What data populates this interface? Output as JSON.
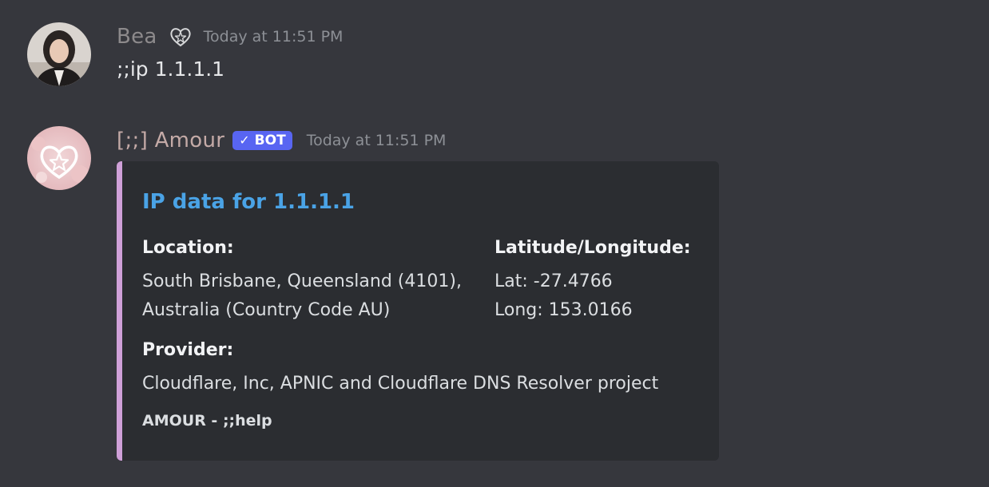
{
  "messages": [
    {
      "author": "Bea",
      "badge_icon": "heart-star-icon",
      "timestamp": "Today at 11:51 PM",
      "content": ";;ip 1.1.1.1"
    },
    {
      "author": "[;;] Amour",
      "bot_tag": "BOT",
      "timestamp": "Today at 11:51 PM",
      "embed": {
        "title": "IP data for 1.1.1.1",
        "accent_color": "#cfa0d8",
        "fields": {
          "location": {
            "name": "Location:",
            "lines": [
              "South Brisbane, Queensland (4101),",
              "Australia (Country Code AU)"
            ]
          },
          "latlong": {
            "name": "Latitude/Longitude:",
            "lines": [
              "Lat: -27.4766",
              "Long: 153.0166"
            ]
          },
          "provider": {
            "name": "Provider:",
            "lines": [
              "Cloudflare, Inc, APNIC and Cloudflare DNS Resolver project"
            ]
          }
        },
        "footer": "AMOUR - ;;help"
      }
    }
  ],
  "colors": {
    "background": "#36373d",
    "embed_background": "#2b2d31",
    "link_blue": "#4aa3e6",
    "bot_tag": "#5865f2"
  }
}
